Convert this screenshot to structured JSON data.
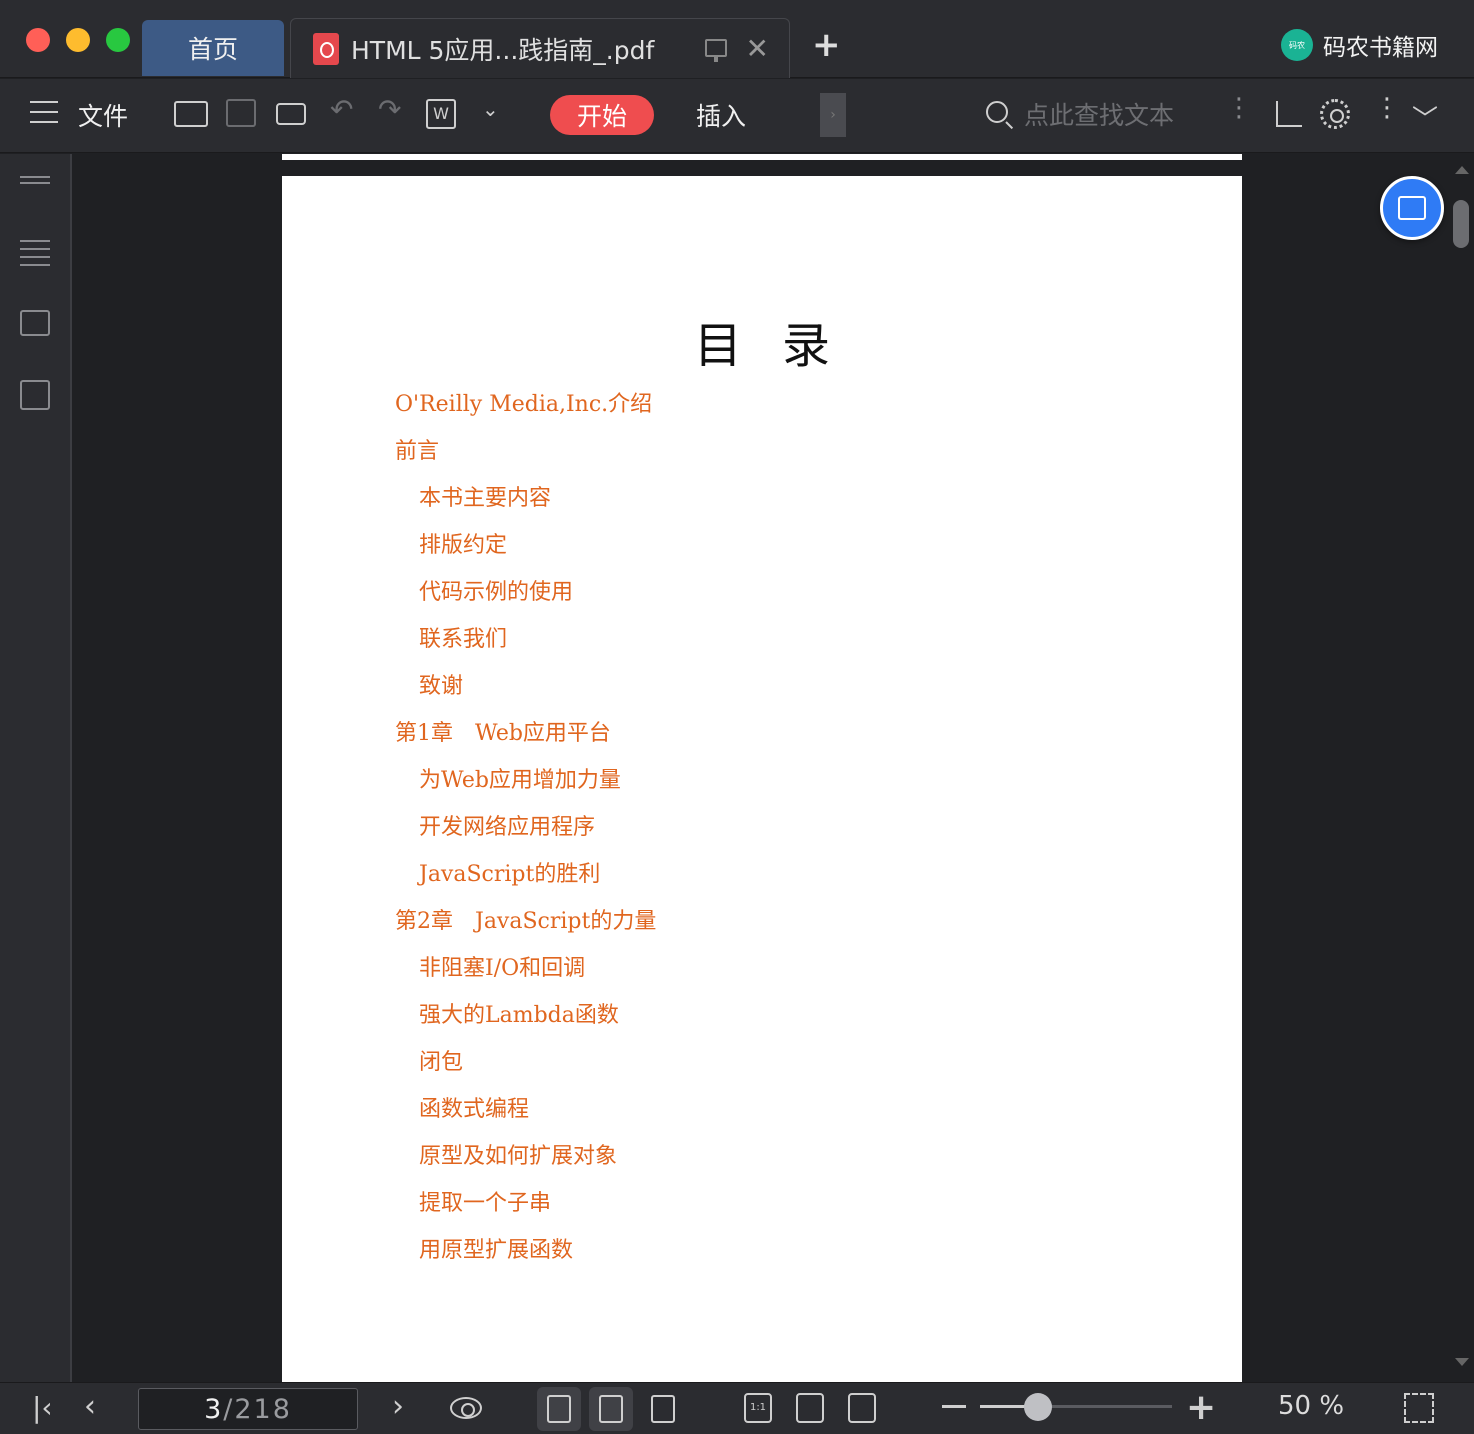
{
  "window": {
    "tabs": [
      {
        "label": "首页",
        "active": false
      },
      {
        "label": "HTML 5应用...践指南_.pdf",
        "active": true
      }
    ],
    "brand": "码农书籍网",
    "brand_logo_text": "码农"
  },
  "toolbar": {
    "file_menu": "文件",
    "start_label": "开始",
    "insert_label": "插入",
    "search_placeholder": "点此查找文本",
    "accent_color": "#ef4d4f"
  },
  "document": {
    "toc_title": "目录",
    "toc_items": [
      {
        "text": "O'Reilly Media,Inc.介绍",
        "level": 1
      },
      {
        "text": "前言",
        "level": 1
      },
      {
        "text": "本书主要内容",
        "level": 2
      },
      {
        "text": "排版约定",
        "level": 2
      },
      {
        "text": "代码示例的使用",
        "level": 2
      },
      {
        "text": "联系我们",
        "level": 2
      },
      {
        "text": "致谢",
        "level": 2
      },
      {
        "text": "第1章　Web应用平台",
        "level": 1
      },
      {
        "text": "为Web应用增加力量",
        "level": 2
      },
      {
        "text": "开发网络应用程序",
        "level": 2
      },
      {
        "text": "JavaScript的胜利",
        "level": 2
      },
      {
        "text": "第2章　JavaScript的力量",
        "level": 1
      },
      {
        "text": "非阻塞I/O和回调",
        "level": 2
      },
      {
        "text": "强大的Lambda函数",
        "level": 2
      },
      {
        "text": "闭包",
        "level": 2
      },
      {
        "text": "函数式编程",
        "level": 2
      },
      {
        "text": "原型及如何扩展对象",
        "level": 2
      },
      {
        "text": "提取一个子串",
        "level": 2
      },
      {
        "text": "用原型扩展函数",
        "level": 2
      }
    ],
    "link_color": "#e0661f"
  },
  "statusbar": {
    "current_page": "3",
    "page_separator": "/",
    "total_pages": "218",
    "zoom_label": "50 %",
    "zoom_fraction": 0.3
  }
}
